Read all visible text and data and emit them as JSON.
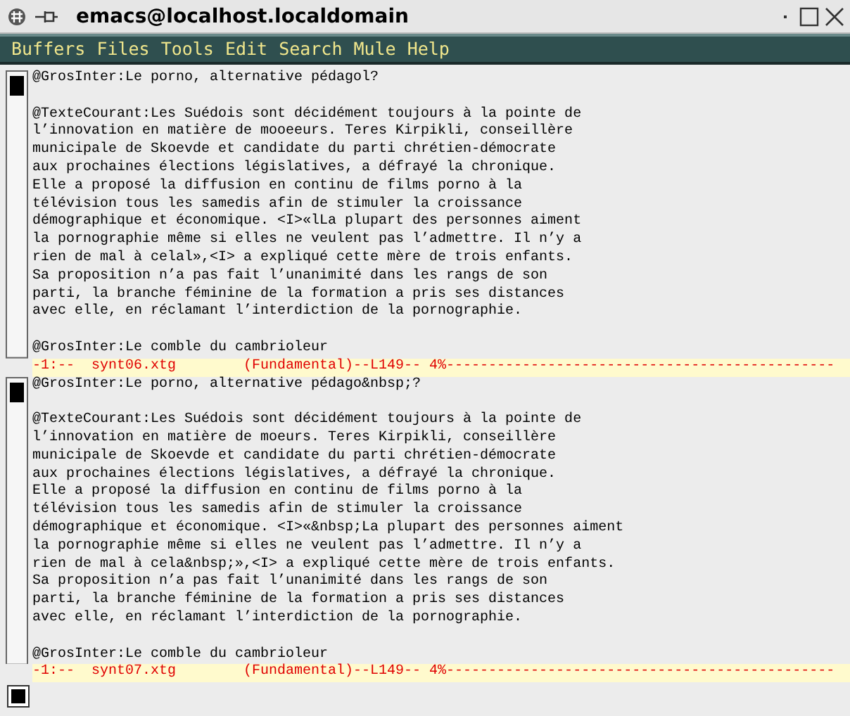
{
  "window": {
    "title": "emacs@localhost.localdomain"
  },
  "menu": [
    "Buffers",
    "Files",
    "Tools",
    "Edit",
    "Search",
    "Mule",
    "Help"
  ],
  "panes": [
    {
      "paragraphs": [
        [
          "@GrosInter:Le porno, alternative pédagol?"
        ],
        [
          "@TexteCourant:Les Suédois sont décidément toujours à la pointe de",
          "l’innovation en matière de mooeeurs. Teres Kirpikli, conseillère",
          "municipale de Skoevde et candidate du parti chrétien-démocrate",
          "aux prochaines élections législatives, a défrayé la chronique.",
          "Elle a proposé la diffusion en continu de films porno à la",
          "télévision tous les samedis afin de stimuler la croissance",
          "démographique et économique. <I>«lLa plupart des personnes aiment",
          "la pornographie même si elles ne veulent pas l’admettre. Il n’y a",
          "rien de mal à celal»,<I> a expliqué cette mère de trois enfants.",
          "Sa proposition n’a pas fait l’unanimité dans les rangs de son",
          "parti, la branche féminine de la formation a pris ses distances",
          "avec elle, en réclamant l’interdiction de la pornographie."
        ],
        [
          "@GrosInter:Le comble du cambrioleur"
        ]
      ],
      "mode_line": "-1:--  synt06.xtg        (Fundamental)--L149-- 4%----------------------------------------------"
    },
    {
      "paragraphs": [
        [
          "@GrosInter:Le porno, alternative pédago&nbsp;?"
        ],
        [
          "@TexteCourant:Les Suédois sont décidément toujours à la pointe de",
          "l’innovation en matière de moeurs. Teres Kirpikli, conseillère",
          "municipale de Skoevde et candidate du parti chrétien-démocrate",
          "aux prochaines élections législatives, a défrayé la chronique.",
          "Elle a proposé la diffusion en continu de films porno à la",
          "télévision tous les samedis afin de stimuler la croissance",
          "démographique et économique. <I>«&nbsp;La plupart des personnes aiment",
          "la pornographie même si elles ne veulent pas l’admettre. Il n’y a",
          "rien de mal à cela&nbsp;»,<I> a expliqué cette mère de trois enfants.",
          "Sa proposition n’a pas fait l’unanimité dans les rangs de son",
          "parti, la branche féminine de la formation a pris ses distances",
          "avec elle, en réclamant l’interdiction de la pornographie."
        ],
        [
          "@GrosInter:Le comble du cambrioleur"
        ]
      ],
      "mode_line": "-1:--  synt07.xtg        (Fundamental)--L149-- 4%----------------------------------------------"
    }
  ]
}
